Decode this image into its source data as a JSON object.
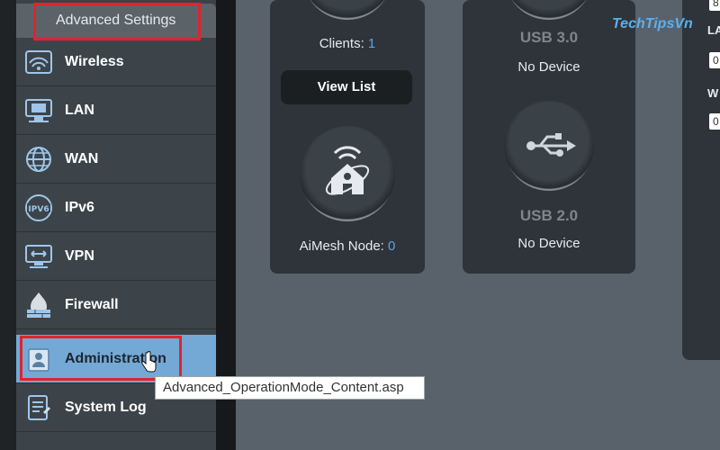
{
  "sidebar": {
    "header": "Advanced Settings",
    "items": [
      {
        "label": "Wireless",
        "icon": "wireless-icon"
      },
      {
        "label": "LAN",
        "icon": "lan-icon"
      },
      {
        "label": "WAN",
        "icon": "globe-icon"
      },
      {
        "label": "IPv6",
        "icon": "ipv6-icon"
      },
      {
        "label": "VPN",
        "icon": "vpn-icon"
      },
      {
        "label": "Firewall",
        "icon": "firewall-icon"
      },
      {
        "label": "Administration",
        "icon": "administration-icon",
        "active": true
      },
      {
        "label": "System Log",
        "icon": "system-log-icon"
      }
    ]
  },
  "tooltip": "Advanced_OperationMode_Content.asp",
  "clients_card": {
    "clients_label": "Clients:",
    "clients_count": "1",
    "view_list": "View List",
    "aimesh_label": "AiMesh Node:",
    "aimesh_count": "0"
  },
  "usb_card": {
    "usb3_label": "USB 3.0",
    "usb3_status": "No Device",
    "usb2_label": "USB 2.0",
    "usb2_status": "No Device"
  },
  "watermark": "TechTipsVn",
  "right_panel": {
    "row1_text": "8",
    "row2_label": "LA",
    "row2_value": "0",
    "row3_label": "W",
    "row3_value": "0"
  },
  "colors": {
    "accent": "#5ea4e2",
    "highlight": "#e0242c",
    "active_item": "#74a9d6"
  }
}
